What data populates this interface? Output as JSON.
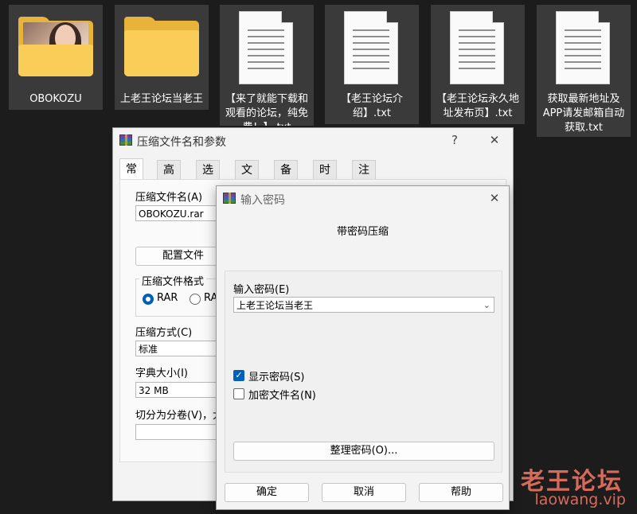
{
  "desktop": {
    "items": [
      {
        "label": "OBOKOZU",
        "kind": "folder-with-photo"
      },
      {
        "label": "上老王论坛当老王",
        "kind": "folder"
      },
      {
        "label": "【来了就能下载和观看的论坛，纯免费！】.txt",
        "kind": "text-file"
      },
      {
        "label": "【老王论坛介绍】.txt",
        "kind": "text-file"
      },
      {
        "label": "【老王论坛永久地址发布页】.txt",
        "kind": "text-file"
      },
      {
        "label": "获取最新地址及APP请发邮箱自动获取.txt",
        "kind": "text-file"
      }
    ]
  },
  "watermark": {
    "line1": "老王论坛",
    "line2": "laowang.vip",
    "color": "#d86a5a"
  },
  "archive_dialog": {
    "title": "压缩文件名和参数",
    "help_glyph": "?",
    "close_glyph": "✕",
    "tabs": [
      "常规",
      "高级",
      "选项",
      "文件",
      "备份",
      "时间",
      "注释"
    ],
    "active_tab": "常规",
    "archive_name_label": "压缩文件名(A)",
    "archive_name_value": "OBOKOZU.rar",
    "profiles_button": "配置文件",
    "format_label": "压缩文件格式",
    "format_options": [
      "RAR",
      "RAR"
    ],
    "format_selected": "RAR",
    "method_label": "压缩方式(C)",
    "method_value": "标准",
    "dict_label": "字典大小(I)",
    "dict_value": "32 MB",
    "split_label": "切分为分卷(V)，大小",
    "split_value": ""
  },
  "password_dialog": {
    "title": "输入密码",
    "close_glyph": "✕",
    "heading": "带密码压缩",
    "password_label": "输入密码(E)",
    "password_value": "上老王论坛当老王",
    "show_password_label": "显示密码(S)",
    "show_password_checked": true,
    "encrypt_names_label": "加密文件名(N)",
    "encrypt_names_checked": false,
    "organize_button": "整理密码(O)...",
    "ok_button": "确定",
    "cancel_button": "取消",
    "help_button": "帮助"
  },
  "colors": {
    "accent": "#005fb8",
    "folder": "#f9cd57",
    "desktop_bg": "#1c1c1c"
  }
}
